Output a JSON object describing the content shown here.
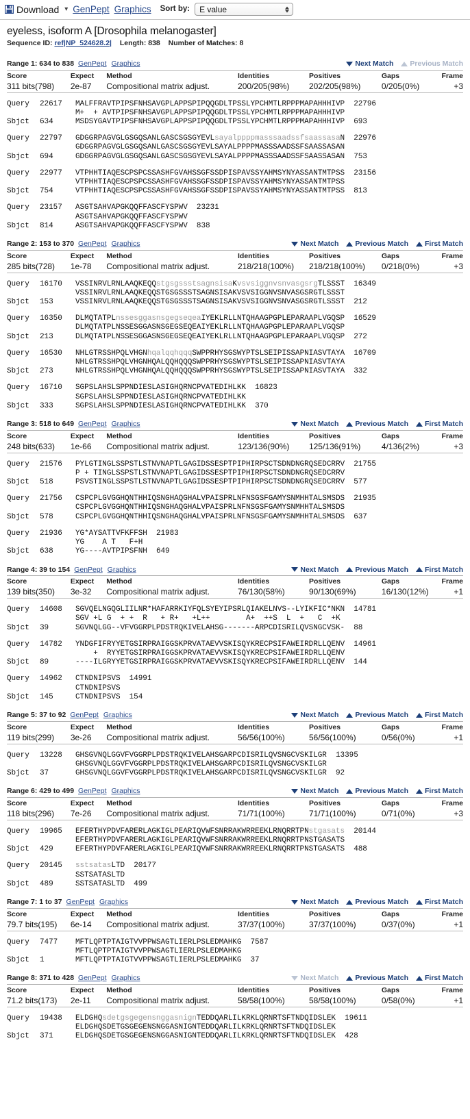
{
  "toolbar": {
    "download_label": "Download",
    "download_icon": "floppy-disk-icon",
    "caret_icon": "chevron-down-icon",
    "genpept_label": "GenPept",
    "graphics_label": "Graphics",
    "sort_by_label": "Sort by:",
    "sort_value": "E value",
    "link_color": "#2a4b8d"
  },
  "defline": {
    "title": "eyeless, isoform A [Drosophila melanogaster]",
    "sequence_id_label": "Sequence ID:",
    "sequence_id": "ref|NP_524628.2|",
    "length_label": "Length:",
    "length": "838",
    "matches_label": "Number of Matches:",
    "matches": "8"
  },
  "stats_headers": {
    "score": "Score",
    "expect": "Expect",
    "method": "Method",
    "identities": "Identities",
    "positives": "Positives",
    "gaps": "Gaps",
    "frame": "Frame"
  },
  "nav_labels": {
    "next": "Next Match",
    "previous": "Previous Match",
    "first": "First Match"
  },
  "row_labels": {
    "query": "Query",
    "sbjct": "Sbjct"
  },
  "links": {
    "genpept": "GenPept",
    "graphics": "Graphics"
  },
  "alignments": [
    {
      "range_title": "Range 1: 634 to 838",
      "has_next": true,
      "has_previous": false,
      "has_first": false,
      "score": "311 bits(798)",
      "expect": "2e-87",
      "method": "Compositional matrix adjust.",
      "identities": "200/205(98%)",
      "positives": "202/205(98%)",
      "gaps": "0/205(0%)",
      "frame": "+3",
      "blocks": [
        {
          "q_start": "22617",
          "q_seq": "MALFFRAVTPIPSFNHSAVGPLAPPSPIPQQGDLTPSSLYPCHMTLRPPPMAPAHHHIVP",
          "q_lc": "",
          "q_end": "22796",
          "midline": "M+  + AVTPIPSFNHSAVGPLAPPSPIPQQGDLTPSSLYPCHMTLRPPPMAPAHHHIVP",
          "s_start": "634",
          "s_seq": "MSDSYGAVTPIPSFNHSAVGPLAPPSPIPQQGDLTPSSLYPCHMTLRPPPMAPAHHHIVP",
          "s_end": "693"
        },
        {
          "q_start": "22797",
          "q_seq": "GDGGRPAGVGLGSGQSANLGASCSGSGYEVL",
          "q_lc": "sayalppppmasssaadssfsaassasa",
          "q_tail": "N",
          "q_end": "22976",
          "midline": "GDGGRPAGVGLGSGQSANLGASCSGSGYEVLSAYALPPPPMASSSAADSSFSAASSASAN",
          "s_start": "694",
          "s_seq": "GDGGRPAGVGLGSGQSANLGASCSGSGYEVLSAYALPPPPMASSSAADSSFSAASSASAN",
          "s_end": "753"
        },
        {
          "q_start": "22977",
          "q_seq": "VTPHHTIAQESCPSPCSSASHFGVAHSSGFSSDPISPAVSSYAHMSYNYASSANTMTPSS",
          "q_lc": "",
          "q_end": "23156",
          "midline": "VTPHHTIAQESCPSPCSSASHFGVAHSSGFSSDPISPAVSSYAHMSYNYASSANTMTPSS",
          "s_start": "754",
          "s_seq": "VTPHHTIAQESCPSPCSSASHFGVAHSSGFSSDPISPAVSSYAHMSYNYASSANTMTPSS",
          "s_end": "813"
        },
        {
          "q_start": "23157",
          "q_seq": "ASGTSAHVAPGKQQFFASCFYSPWV",
          "q_lc": "",
          "q_end": "23231",
          "midline": "ASGTSAHVAPGKQQFFASCFYSPWV",
          "s_start": "814",
          "s_seq": "ASGTSAHVAPGKQQFFASCFYSPWV",
          "s_end": "838"
        }
      ]
    },
    {
      "range_title": "Range 2: 153 to 370",
      "has_next": true,
      "has_previous": true,
      "has_first": true,
      "score": "285 bits(728)",
      "expect": "1e-78",
      "method": "Compositional matrix adjust.",
      "identities": "218/218(100%)",
      "positives": "218/218(100%)",
      "gaps": "0/218(0%)",
      "frame": "+3",
      "blocks": [
        {
          "q_start": "16170",
          "q_seq": "VSSINRVLRNLAAQKEQQ",
          "q_lc": "stgsgssstsagnsisa",
          "q_tail": "K",
          "q_lc2": "vsvsiggnvsnvasgsrg",
          "q_tail2": "TLSSST",
          "q_end": "16349",
          "midline": "VSSINRVLRNLAAQKEQQSTGSGSSSTSAGNSISAKVSVSIGGNVSNVASGSRGTLSSST",
          "s_start": "153",
          "s_seq": "VSSINRVLRNLAAQKEQQSTGSGSSSTSAGNSISAKVSVSIGGNVSNVASGSRGTLSSST",
          "s_end": "212"
        },
        {
          "q_start": "16350",
          "q_seq": "DLMQTATPL",
          "q_lc": "nssesggasnsgegseqea",
          "q_tail": "IYEKLRLLNTQHAAGPGPLEPARAAPLVGQSP",
          "q_end": "16529",
          "midline": "DLMQTATPLNSSESGGASNSGEGSEQEAIYEKLRLLNTQHAAGPGPLEPARAAPLVGQSP",
          "s_start": "213",
          "s_seq": "DLMQTATPLNSSESGGASNSGEGSEQEAIYEKLRLLNTQHAAGPGPLEPARAAPLVGQSP",
          "s_end": "272"
        },
        {
          "q_start": "16530",
          "q_seq": "NHLGTRSSHPQLVHGN",
          "q_lc": "hqalqqhqqq",
          "q_tail": "SWPPRHYSGSWYPTSLSEIPISSAPNIASVTAYA",
          "q_end": "16709",
          "midline": "NHLGTRSSHPQLVHGNHQALQQHQQQSWPPRHYSGSWYPTSLSEIPISSAPNIASVTAYA",
          "s_start": "273",
          "s_seq": "NHLGTRSSHPQLVHGNHQALQQHQQQSWPPRHYSGSWYPTSLSEIPISSAPNIASVTAYA",
          "s_end": "332"
        },
        {
          "q_start": "16710",
          "q_seq": "SGPSLAHSLSPPNDIESLASIGHQRNCPVATEDIHLKK",
          "q_lc": "",
          "q_end": "16823",
          "midline": "SGPSLAHSLSPPNDIESLASIGHQRNCPVATEDIHLKK",
          "s_start": "333",
          "s_seq": "SGPSLAHSLSPPNDIESLASIGHQRNCPVATEDIHLKK",
          "s_end": "370"
        }
      ]
    },
    {
      "range_title": "Range 3: 518 to 649",
      "has_next": true,
      "has_previous": true,
      "has_first": true,
      "score": "248 bits(633)",
      "expect": "1e-66",
      "method": "Compositional matrix adjust.",
      "identities": "123/136(90%)",
      "positives": "125/136(91%)",
      "gaps": "4/136(2%)",
      "frame": "+3",
      "blocks": [
        {
          "q_start": "21576",
          "q_seq": "PYLGTINGLSSPSTLSTNVNAPTLGAGIDSSESPTPIPHIRPSCTSDNDNGRQSEDCRRV",
          "q_lc": "",
          "q_end": "21755",
          "midline": "P + TINGLSSPSTLSTNVNAPTLGAGIDSSESPTPIPHIRPSCTSDNDNGRQSEDCRRV",
          "s_start": "518",
          "s_seq": "PSVSTINGLSSPSTLSTNVNAPTLGAGIDSSESPTPIPHIRPSCTSDNDNGRQSEDCRRV",
          "s_end": "577"
        },
        {
          "q_start": "21756",
          "q_seq": "CSPCPLGVGGHQNTHHIQSNGHAQGHALVPAISPRLNFNSGSFGAMYSNMHHTALSMSDS",
          "q_lc": "",
          "q_end": "21935",
          "midline": "CSPCPLGVGGHQNTHHIQSNGHAQGHALVPAISPRLNFNSGSFGAMYSNMHHTALSMSDS",
          "s_start": "578",
          "s_seq": "CSPCPLGVGGHQNTHHIQSNGHAQGHALVPAISPRLNFNSGSFGAMYSNMHHTALSMSDS",
          "s_end": "637"
        },
        {
          "q_start": "21936",
          "q_seq": "YG*AYSATTVFKFFSH",
          "q_lc": "",
          "q_end": "21983",
          "midline": "YG    A T   F+H",
          "s_start": "638",
          "s_seq": "YG----AVTPIPSFNH",
          "s_end": "649"
        }
      ]
    },
    {
      "range_title": "Range 4: 39 to 154",
      "has_next": true,
      "has_previous": true,
      "has_first": true,
      "score": "139 bits(350)",
      "expect": "3e-32",
      "method": "Compositional matrix adjust.",
      "identities": "76/130(58%)",
      "positives": "90/130(69%)",
      "gaps": "16/130(12%)",
      "frame": "+1",
      "blocks": [
        {
          "q_start": "14608",
          "q_seq": "SGVQELNGQGLIILNR*HAFARRKIYFQLSYEYIPSRLQIAKELNVS--LYIKFIC*NKN",
          "q_lc": "",
          "q_end": "14781",
          "midline": "SGV +L G  + +  R   + R+   +L++        A+  ++S  L  +   C  +K",
          "s_start": "39",
          "s_seq": "SGVNQLGG--VFVGGRPLPDSTRQKIVELAHSG-------ARPCDISRILQVSNGCVSK-",
          "s_end": "88"
        },
        {
          "q_start": "14782",
          "q_seq": "YNDGFIFRYYETGSIRPRAIGGSKPRVATAEVVSKISQYKRECPSIFAWEIRDRLLQENV",
          "q_lc": "",
          "q_end": "14961",
          "midline": "    +  RYYETGSIRPRAIGGSKPRVATAEVVSKISQYKRECPSIFAWEIRDRLLQENV",
          "s_start": "89",
          "s_seq": "----ILGRYYETGSIRPRAIGGSKPRVATAEVVSKISQYKRECPSIFAWEIRDRLLQENV",
          "s_end": "144"
        },
        {
          "q_start": "14962",
          "q_seq": "CTNDNIPSVS",
          "q_lc": "",
          "q_end": "14991",
          "midline": "CTNDNIPSVS",
          "s_start": "145",
          "s_seq": "CTNDNIPSVS",
          "s_end": "154"
        }
      ]
    },
    {
      "range_title": "Range 5: 37 to 92",
      "has_next": true,
      "has_previous": true,
      "has_first": true,
      "score": "119 bits(299)",
      "expect": "3e-26",
      "method": "Compositional matrix adjust.",
      "identities": "56/56(100%)",
      "positives": "56/56(100%)",
      "gaps": "0/56(0%)",
      "frame": "+1",
      "blocks": [
        {
          "q_start": "13228",
          "q_seq": "GHSGVNQLGGVFVGGRPLPDSTRQKIVELAHSGARPCDISRILQVSNGCVSKILGR",
          "q_lc": "",
          "q_end": "13395",
          "midline": "GHSGVNQLGGVFVGGRPLPDSTRQKIVELAHSGARPCDISRILQVSNGCVSKILGR",
          "s_start": "37",
          "s_seq": "GHSGVNQLGGVFVGGRPLPDSTRQKIVELAHSGARPCDISRILQVSNGCVSKILGR",
          "s_end": "92"
        }
      ]
    },
    {
      "range_title": "Range 6: 429 to 499",
      "has_next": true,
      "has_previous": true,
      "has_first": true,
      "score": "118 bits(296)",
      "expect": "7e-26",
      "method": "Compositional matrix adjust.",
      "identities": "71/71(100%)",
      "positives": "71/71(100%)",
      "gaps": "0/71(0%)",
      "frame": "+3",
      "blocks": [
        {
          "q_start": "19965",
          "q_seq": "EFERTHYPDVFARERLAGKIGLPEARIQVWFSNRRAKWRREEKLRNQRRTPN",
          "q_lc": "stgasats",
          "q_end": "20144",
          "midline": "EFERTHYPDVFARERLAGKIGLPEARIQVWFSNRRAKWRREEKLRNQRRTPNSTGASATS",
          "s_start": "429",
          "s_seq": "EFERTHYPDVFARERLAGKIGLPEARIQVWFSNRRAKWRREEKLRNQRRTPNSTGASATS",
          "s_end": "488"
        },
        {
          "q_start": "20145",
          "q_seq": "",
          "q_lc": "sstsatas",
          "q_tail": "LTD",
          "q_end": "20177",
          "midline": "SSTSATASLTD",
          "s_start": "489",
          "s_seq": "SSTSATASLTD",
          "s_end": "499"
        }
      ]
    },
    {
      "range_title": "Range 7: 1 to 37",
      "has_next": true,
      "has_previous": true,
      "has_first": true,
      "score": "79.7 bits(195)",
      "expect": "6e-14",
      "method": "Compositional matrix adjust.",
      "identities": "37/37(100%)",
      "positives": "37/37(100%)",
      "gaps": "0/37(0%)",
      "frame": "+1",
      "blocks": [
        {
          "q_start": "7477",
          "q_seq": "MFTLQPTPTAIGTVVPPWSAGTLIERLPSLEDMAHKG",
          "q_lc": "",
          "q_end": "7587",
          "midline": "MFTLQPTPTAIGTVVPPWSAGTLIERLPSLEDMAHKG",
          "s_start": "1",
          "s_seq": "MFTLQPTPTAIGTVVPPWSAGTLIERLPSLEDMAHKG",
          "s_end": "37"
        }
      ]
    },
    {
      "range_title": "Range 8: 371 to 428",
      "has_next": false,
      "has_previous": true,
      "has_first": true,
      "score": "71.2 bits(173)",
      "expect": "2e-11",
      "method": "Compositional matrix adjust.",
      "identities": "58/58(100%)",
      "positives": "58/58(100%)",
      "gaps": "0/58(0%)",
      "frame": "+1",
      "blocks": [
        {
          "q_start": "19438",
          "q_seq": "ELDGHQ",
          "q_lc": "sdetgsgegensnggasnign",
          "q_tail": "TEDDQARLILKRKLQRNRTSFTNDQIDSLEK",
          "q_end": "19611",
          "midline": "ELDGHQSDETGSGEGENSNGGASNIGNTEDDQARLILKRKLQRNRTSFTNDQIDSLEK",
          "s_start": "371",
          "s_seq": "ELDGHQSDETGSGEGENSNGGASNIGNTEDDQARLILKRKLQRNRTSFTNDQIDSLEK",
          "s_end": "428"
        }
      ]
    }
  ]
}
